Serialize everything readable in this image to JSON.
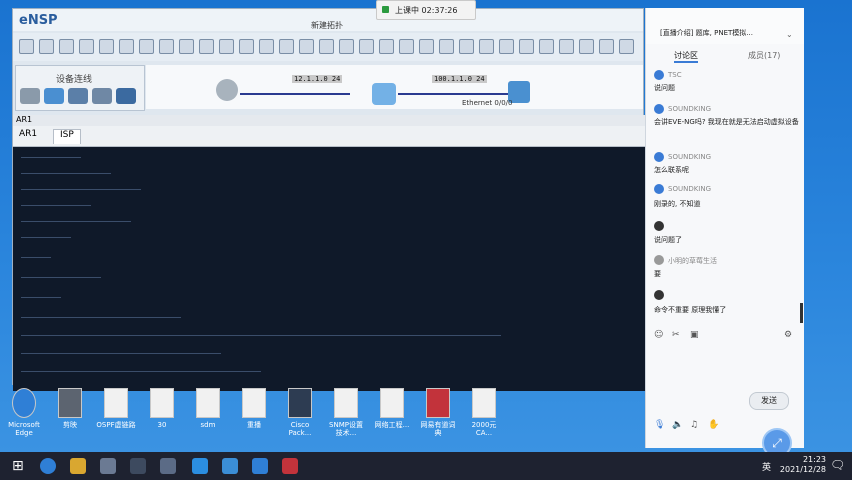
{
  "ensp": {
    "logo": "eNSP",
    "window_title": "新建拓扑",
    "device_panel_title": "设备连线",
    "topology": {
      "label_left": "12.1.1.0 24",
      "label_right": "100.1.1.0 24",
      "label_bottom": "Ethernet 0/0/0"
    }
  },
  "console": {
    "title": "AR1",
    "tabs": [
      "AR1",
      "ISP"
    ]
  },
  "timer": {
    "text": "上课中 02:37:26"
  },
  "desktop_icons": [
    {
      "name": "Microsoft Edge",
      "color": "#2f7fd6"
    },
    {
      "name": "剪映",
      "color": "#5c6470"
    },
    {
      "name": "OSPF虚链路",
      "color": "#f1f1f1"
    },
    {
      "name": "30",
      "color": "#f1f1f1"
    },
    {
      "name": "sdm",
      "color": "#f1f1f1"
    },
    {
      "name": "重播",
      "color": "#f1f1f1"
    },
    {
      "name": "Cisco Pack...",
      "color": "#2d3c52"
    },
    {
      "name": "SNMP设置技术...",
      "color": "#f1f1f1"
    },
    {
      "name": "网络工程...",
      "color": "#f1f1f1"
    },
    {
      "name": "网易有道词典",
      "color": "#c2333b"
    },
    {
      "name": "2000元CA...",
      "color": "#f1f1f1"
    }
  ],
  "chat": {
    "header": "[直播介绍] 题库, PNET模拟...",
    "tab_discussion": "讨论区",
    "tab_members": "成员(17)",
    "messages": [
      {
        "user": "TSC",
        "text": "说问题"
      },
      {
        "user": "SOUNDKING",
        "text": "会讲EVE-NG吗? 我现在就是无法启动虚拟设备"
      },
      {
        "user": "SOUNDKING",
        "text": "怎么联系呢"
      },
      {
        "user": "SOUNDKING",
        "text": "刚录的, 不知道"
      },
      {
        "user": "",
        "text": "说问题了"
      },
      {
        "user": "小明的草莓生活",
        "text": "要"
      },
      {
        "user": "",
        "text": "命令不重要 原理我懂了"
      }
    ],
    "send_label": "发送"
  },
  "taskbar": {
    "ime": "英",
    "time": "21:23",
    "date": "2021/12/28"
  },
  "colors": {
    "desktop": "#2b86dd",
    "terminal": "#0f1929",
    "taskbar": "#1e2230",
    "accent": "#3a7bd5"
  }
}
